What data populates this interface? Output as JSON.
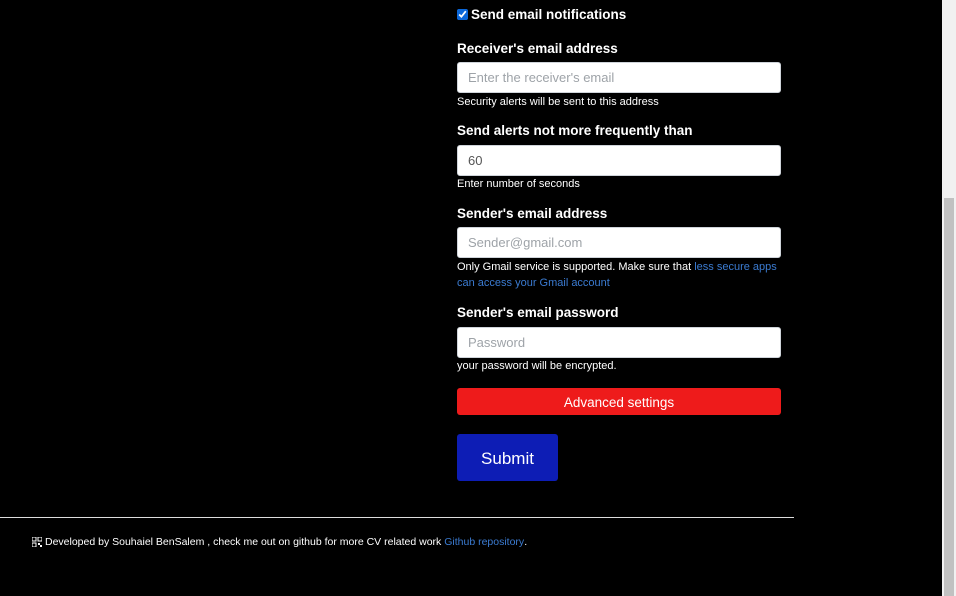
{
  "form": {
    "notifications_label": "Send email notifications",
    "notifications_checked": true,
    "receiver": {
      "label": "Receiver's email address",
      "placeholder": "Enter the receiver's email",
      "help": "Security alerts will be sent to this address"
    },
    "frequency": {
      "label": "Send alerts not more frequently than",
      "value": "60",
      "help": "Enter number of seconds"
    },
    "sender": {
      "label": "Sender's email address",
      "placeholder": "Sender@gmail.com",
      "help_prefix": "Only Gmail service is supported. Make sure that ",
      "help_link": "less secure apps can access your Gmail account"
    },
    "password": {
      "label": "Sender's email password",
      "placeholder": "Password",
      "help": "your password will be encrypted."
    },
    "advanced_label": "Advanced settings",
    "submit_label": "Submit"
  },
  "footer": {
    "text": "Developed by Souhaiel BenSalem , check me out on github for more CV related work ",
    "link": "Github repository",
    "suffix": "."
  },
  "colors": {
    "background": "#000000",
    "advanced_button": "#ee1b1b",
    "submit_button": "#0d1db5",
    "link": "#3b7bd1"
  }
}
